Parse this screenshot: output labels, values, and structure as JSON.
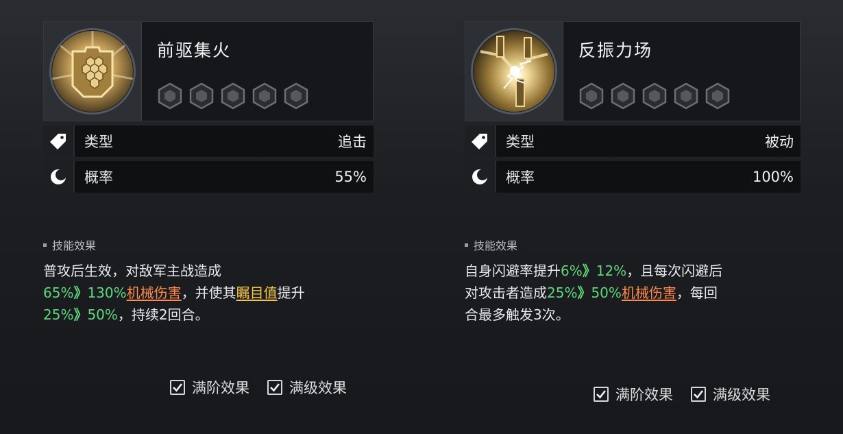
{
  "cards": [
    {
      "name": "前驱集火",
      "rows": [
        {
          "label": "类型",
          "value": "追击",
          "icon": "tag-icon"
        },
        {
          "label": "概率",
          "value": "55%",
          "icon": "moon-icon"
        }
      ],
      "effect_title": "技能效果",
      "desc": {
        "l1": "普攻后生效，对敌军主战造成",
        "v1a": "65%",
        "v1b": "130%",
        "dmg": "机械伤害",
        "mid": "，并使其",
        "buff": "瞩目值",
        "tail": "提升",
        "v2a": "25%",
        "v2b": "50%",
        "end": "，持续2回合。"
      }
    },
    {
      "name": "反振力场",
      "rows": [
        {
          "label": "类型",
          "value": "被动",
          "icon": "tag-icon"
        },
        {
          "label": "概率",
          "value": "100%",
          "icon": "moon-icon"
        }
      ],
      "effect_title": "技能效果",
      "desc": {
        "l1": "自身闪避率提升",
        "v1a": "6%",
        "v1b": "12%",
        "mid": "，且每次闪避后",
        "l2": "对攻击者造成",
        "v2a": "25%",
        "v2b": "50%",
        "dmg": "机械伤害",
        "tail": "，每回",
        "end": "合最多触发3次。"
      }
    }
  ],
  "arrow": "》",
  "checks": {
    "full_rank": "满阶效果",
    "full_level": "满级效果"
  },
  "colors": {
    "highlight_green": "#5fd87c",
    "damage_orange": "#ff8a4a",
    "buff_yellow": "#f5c542"
  }
}
